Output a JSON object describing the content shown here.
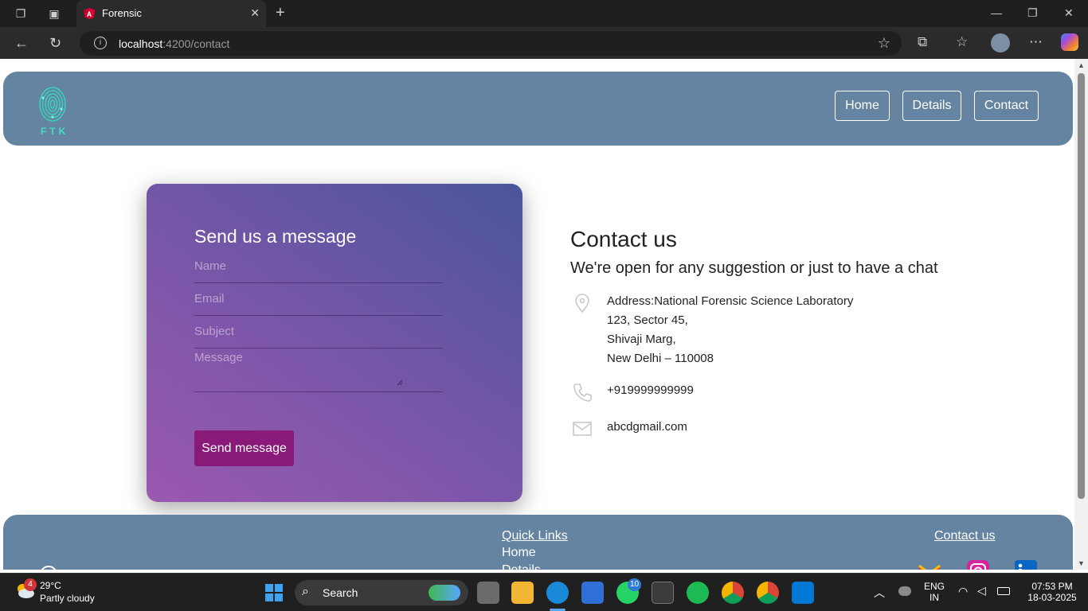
{
  "browser": {
    "tab_title": "Forensic",
    "url_host": "localhost",
    "url_path": ":4200/contact",
    "new_tab_symbol": "+"
  },
  "header": {
    "logo_text": "FTK",
    "nav": [
      "Home",
      "Details",
      "Contact"
    ]
  },
  "form": {
    "title": "Send us a message",
    "name_placeholder": "Name",
    "email_placeholder": "Email",
    "subject_placeholder": "Subject",
    "message_placeholder": "Message",
    "submit_label": "Send message"
  },
  "contact": {
    "title": "Contact us",
    "subtitle": "We're open for any suggestion or just to have a chat",
    "address_lines": [
      "Address:National Forensic Science Laboratory",
      "123, Sector 45,",
      "Shivaji Marg,",
      "New Delhi – 110008"
    ],
    "phone": "+919999999999",
    "email": "abcdgmail.com"
  },
  "footer": {
    "quick_links_title": "Quick Links",
    "quick_links": [
      "Home",
      "Details"
    ],
    "contact_title": "Contact us",
    "social_icons": [
      "gmail-icon",
      "instagram-icon",
      "linkedin-icon"
    ]
  },
  "taskbar": {
    "temperature": "29°C",
    "weather": "Partly cloudy",
    "weather_badge": "4",
    "search_label": "Search",
    "whatsapp_badge": "10",
    "lang_top": "ENG",
    "lang_bottom": "IN",
    "time": "07:53 PM",
    "date": "18-03-2025"
  },
  "colors": {
    "header_bg": "#6584a1",
    "card_gradient_start": "#9b59b0",
    "card_gradient_end": "#4a559c",
    "send_button": "#8a1a7a",
    "logo_teal": "#3ee0c0"
  }
}
